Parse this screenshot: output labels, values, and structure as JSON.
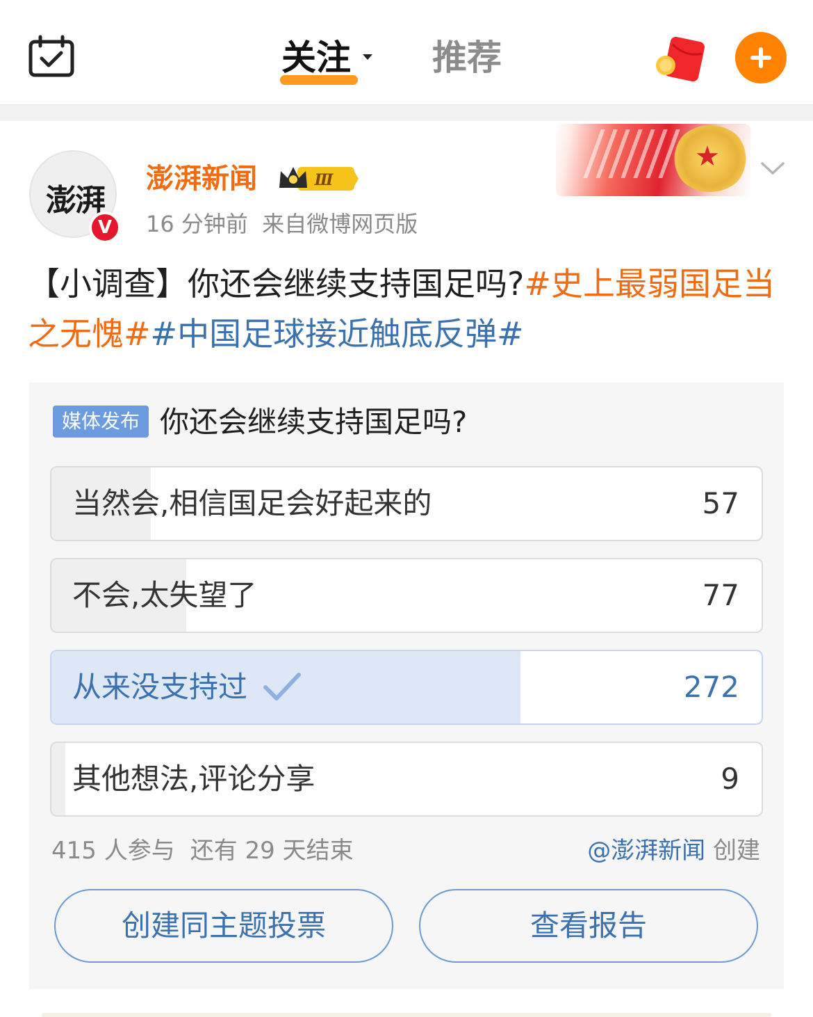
{
  "nav": {
    "tabs": [
      {
        "label": "关注",
        "active": true
      },
      {
        "label": "推荐",
        "active": false
      }
    ],
    "left_icon": "calendar-check-icon",
    "right_icons": [
      "red-packet-icon",
      "add-icon"
    ],
    "accent_color": "#ff8200"
  },
  "post": {
    "author": {
      "name": "澎湃新闻",
      "avatar_text": "澎湃",
      "verified_badge": "V",
      "level_badge": "Ⅲ"
    },
    "time": "16 分钟前",
    "source": "来自微博网页版",
    "text": {
      "prefix": "【小调查】你还会继续支持国足吗?",
      "hashtag1": "#史上最弱国足当之无愧#",
      "hashtag2": "#中国足球接近触底反弹#"
    }
  },
  "poll": {
    "badge": "媒体发布",
    "question": "你还会继续支持国足吗?",
    "options": [
      {
        "label": "当然会,相信国足会好起来的",
        "count": "57",
        "share": 0.14,
        "selected": false
      },
      {
        "label": "不会,太失望了",
        "count": "77",
        "share": 0.19,
        "selected": false
      },
      {
        "label": "从来没支持过",
        "count": "272",
        "share": 0.66,
        "selected": true
      },
      {
        "label": "其他想法,评论分享",
        "count": "9",
        "share": 0.02,
        "selected": false
      }
    ],
    "participants": "415 人参与",
    "remaining": "还有 29 天结束",
    "creator": "@澎湃新闻",
    "creator_suffix": "创建",
    "buttons": {
      "create": "创建同主题投票",
      "report": "查看报告"
    },
    "colors": {
      "link_blue": "#3a72b0",
      "badge_blue": "#6d9be0",
      "author_orange": "#f06b11"
    }
  }
}
